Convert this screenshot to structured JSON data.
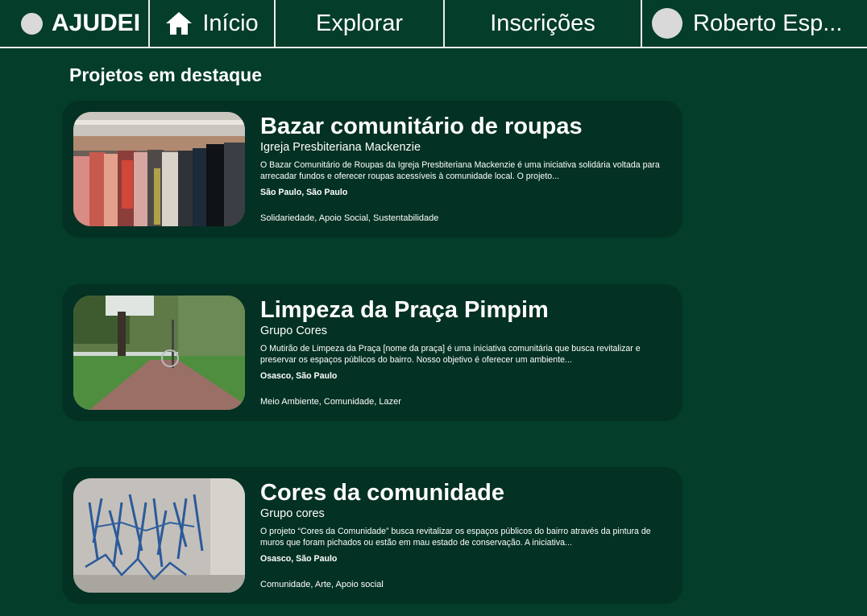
{
  "nav": {
    "brand": "AJUDEI",
    "home": "Início",
    "explore": "Explorar",
    "subscriptions": "Inscrições",
    "profile": "Roberto Esp..."
  },
  "section_title": "Projetos em destaque",
  "projects": [
    {
      "title": "Bazar comunitário de roupas",
      "org": "Igreja Presbiteriana Mackenzie",
      "description": "O Bazar Comunitário de Roupas da Igreja Presbiteriana Mackenzie é uma iniciativa solidária voltada para arrecadar fundos e oferecer roupas acessíveis à comunidade local. O projeto...",
      "location": "São Paulo, São Paulo",
      "tags": "Solidariedade, Apoio Social, Sustentabilidade"
    },
    {
      "title": "Limpeza da Praça Pimpim",
      "org": "Grupo Cores",
      "description": "O Mutirão de Limpeza da Praça [nome da praça] é uma iniciativa comunitária que busca revitalizar e preservar os espaços públicos do bairro. Nosso objetivo é oferecer um ambiente...",
      "location": "Osasco, São Paulo",
      "tags": "Meio Ambiente, Comunidade, Lazer"
    },
    {
      "title": "Cores da comunidade",
      "org": "Grupo cores",
      "description": "O projeto “Cores da Comunidade” busca revitalizar os espaços públicos do bairro através da pintura de muros que foram pichados ou estão em mau estado de conservação. A iniciativa...",
      "location": "Osasco, São Paulo",
      "tags": "Comunidade, Arte, Apoio social"
    }
  ],
  "colors": {
    "background": "#043d29",
    "card": "#033123",
    "text": "#ffffff",
    "avatar": "#d9d9d9"
  }
}
